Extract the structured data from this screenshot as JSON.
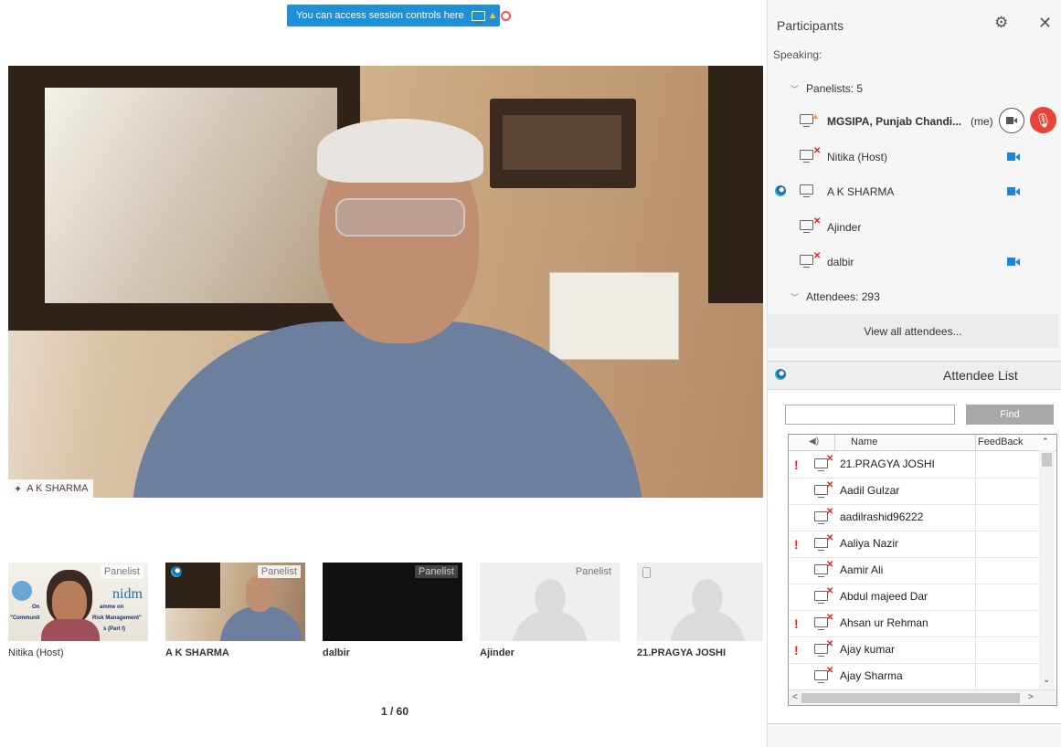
{
  "banner": {
    "text": "You can access session controls here"
  },
  "main_video": {
    "label": "A K SHARMA"
  },
  "thumbnails": [
    {
      "name": "Nitika (Host)",
      "tag": "Panelist",
      "logo": "nidm",
      "overlay_lines": [
        "On",
        "amme on",
        "\"Communit",
        "Risk Management\"",
        "s (Part I)"
      ]
    },
    {
      "name": "A K SHARMA",
      "tag": "Panelist"
    },
    {
      "name": "dalbir",
      "tag": "Panelist"
    },
    {
      "name": "Ajinder",
      "tag": "Panelist"
    },
    {
      "name": "21.PRAGYA JOSHI",
      "tag": ""
    }
  ],
  "pager": "1 / 60",
  "panel": {
    "title": "Participants",
    "speaking": "Speaking:",
    "panelists_header": "Panelists: 5",
    "panelists": [
      {
        "name": "MGSIPA, Punjab Chandi...",
        "suffix": "(me)"
      },
      {
        "name": "Nitika (Host)"
      },
      {
        "name": "A K SHARMA"
      },
      {
        "name": "Ajinder"
      },
      {
        "name": "dalbir"
      }
    ],
    "attendees_header": "Attendees: 293",
    "view_all": "View all attendees..."
  },
  "attendee_list": {
    "title": "Attendee List",
    "search_value": "",
    "find_label": "Find",
    "columns": {
      "name": "Name",
      "feedback": "FeedBack"
    },
    "rows": [
      {
        "name": "21.PRAGYA JOSHI",
        "warning": true
      },
      {
        "name": "Aadil Gulzar",
        "warning": false
      },
      {
        "name": "aadilrashid96222",
        "warning": false
      },
      {
        "name": "Aaliya Nazir",
        "warning": true
      },
      {
        "name": "Aamir Ali",
        "warning": false
      },
      {
        "name": "Abdul majeed Dar",
        "warning": false
      },
      {
        "name": "Ahsan ur Rehman",
        "warning": true
      },
      {
        "name": "Ajay kumar",
        "warning": true
      },
      {
        "name": "Ajay Sharma",
        "warning": false
      }
    ]
  },
  "colors": {
    "accent": "#1f8fd6",
    "mic_off": "#e8443a",
    "warning": "#e02424"
  }
}
